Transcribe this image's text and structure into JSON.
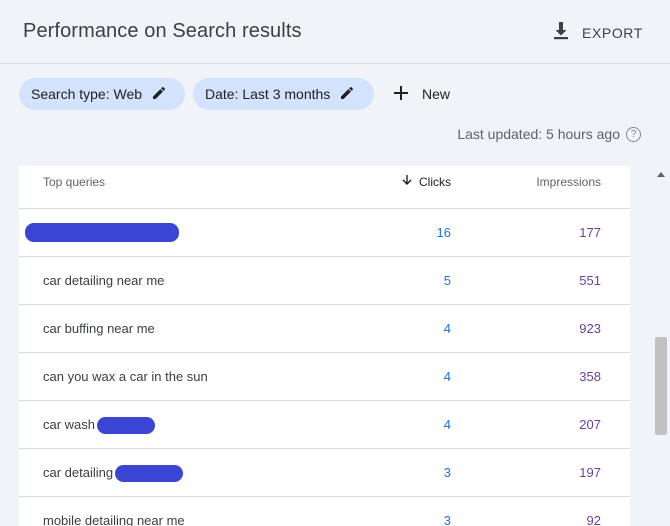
{
  "header": {
    "title": "Performance on Search results",
    "export_label": "EXPORT"
  },
  "filters": {
    "search_type": "Search type: Web",
    "date": "Date: Last 3 months",
    "new_label": "New"
  },
  "status": {
    "last_updated": "Last updated: 5 hours ago",
    "help_glyph": "?"
  },
  "table": {
    "headers": {
      "query": "Top queries",
      "clicks": "Clicks",
      "impressions": "Impressions"
    },
    "rows": [
      {
        "query": "",
        "redacted": true,
        "clicks": "16",
        "impressions": "177"
      },
      {
        "query": "car detailing near me",
        "clicks": "5",
        "impressions": "551"
      },
      {
        "query": "car buffing near me",
        "clicks": "4",
        "impressions": "923"
      },
      {
        "query": "can you wax a car in the sun",
        "clicks": "4",
        "impressions": "358"
      },
      {
        "query": "car wash",
        "redacted_suffix": true,
        "clicks": "4",
        "impressions": "207"
      },
      {
        "query": "car detailing",
        "redacted_suffix": true,
        "clicks": "3",
        "impressions": "197"
      },
      {
        "query": "mobile detailing near me",
        "clicks": "3",
        "impressions": "92"
      }
    ]
  }
}
